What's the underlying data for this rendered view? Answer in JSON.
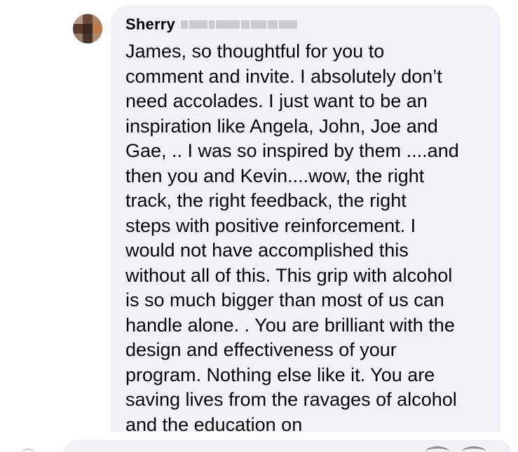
{
  "comment": {
    "author": "Sherry",
    "text": "James, so thoughtful for you to\ncomment and invite. I absolutely don’t\nneed accolades. I just want to be an\ninspiration like Angela, John, Joe and\nGae, .. I was so inspired by them ....and\nthen you and Kevin....wow, the right\ntrack, the right feedback, the right\nsteps with positive reinforcement. I\nwould not have accomplished this\nwithout all of this. This grip with alcohol\nis so much bigger than most of us can\nhandle alone. . You are brilliant with the\ndesign and effectiveness of your\nprogram. Nothing else like it. You are\nsaving lives from the ravages of alcohol\nand the education on"
  },
  "icons": {
    "avatar": "user-avatar-icon",
    "composer_avatar": "user-avatar-icon",
    "composer_actions": [
      "emoji-icon",
      "camera-icon"
    ]
  },
  "colors": {
    "bubble_background": "#f0f2f5",
    "text": "#050505",
    "redacted": "#c9cbcf"
  }
}
